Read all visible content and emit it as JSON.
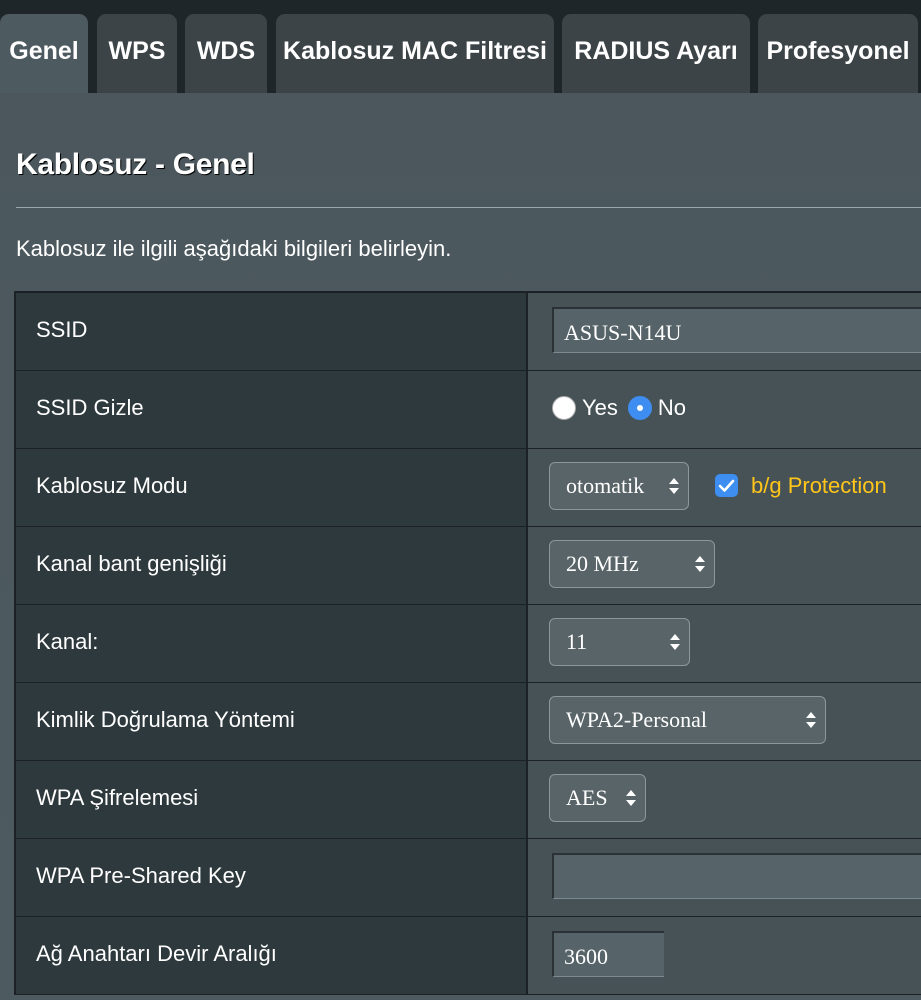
{
  "tabs": [
    {
      "label": "Genel"
    },
    {
      "label": "WPS"
    },
    {
      "label": "WDS"
    },
    {
      "label": "Kablosuz MAC Filtresi"
    },
    {
      "label": "RADIUS Ayarı"
    },
    {
      "label": "Profesyonel"
    }
  ],
  "page": {
    "title": "Kablosuz - Genel",
    "description": "Kablosuz ile ilgili aşağıdaki bilgileri belirleyin."
  },
  "settings": {
    "ssid": {
      "label": "SSID",
      "value": "ASUS-N14U"
    },
    "hide_ssid": {
      "label": "SSID Gizle",
      "yes": "Yes",
      "no": "No",
      "selected": "No"
    },
    "wireless_mode": {
      "label": "Kablosuz Modu",
      "value": "otomatik",
      "protection_label": "b/g Protection",
      "protection_checked": true
    },
    "bandwidth": {
      "label": "Kanal bant genişliği",
      "value": "20 MHz"
    },
    "channel": {
      "label": "Kanal:",
      "value": "11"
    },
    "auth_method": {
      "label": "Kimlik Doğrulama Yöntemi",
      "value": "WPA2-Personal"
    },
    "wpa_encryption": {
      "label": "WPA Şifrelemesi",
      "value": "AES"
    },
    "psk": {
      "label": "WPA Pre-Shared Key",
      "value": ""
    },
    "key_rotation": {
      "label": "Ağ Anahtarı Devir Aralığı",
      "value": "3600"
    }
  },
  "colors": {
    "accent": "#3d8ef0",
    "protection_text": "#ffc619"
  }
}
